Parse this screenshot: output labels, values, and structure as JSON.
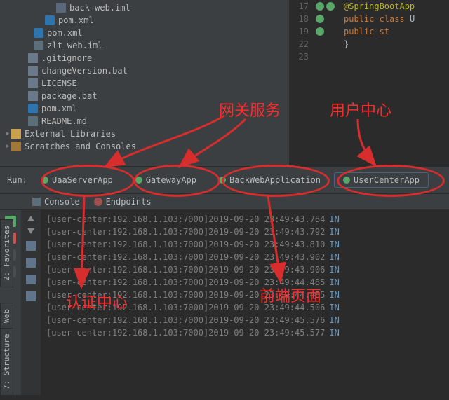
{
  "tree": {
    "items": [
      {
        "indent": 80,
        "icon": "i-folder",
        "label": "back-web.iml"
      },
      {
        "indent": 64,
        "icon": "i-m",
        "label": "pom.xml"
      },
      {
        "indent": 48,
        "icon": "i-m",
        "label": "pom.xml"
      },
      {
        "indent": 48,
        "icon": "i-x",
        "label": "zlt-web.iml"
      },
      {
        "indent": 40,
        "icon": "i-file",
        "label": ".gitignore"
      },
      {
        "indent": 40,
        "icon": "i-file",
        "label": "changeVersion.bat"
      },
      {
        "indent": 40,
        "icon": "i-file",
        "label": "LICENSE"
      },
      {
        "indent": 40,
        "icon": "i-file",
        "label": "package.bat"
      },
      {
        "indent": 40,
        "icon": "i-m",
        "label": "pom.xml"
      },
      {
        "indent": 40,
        "icon": "i-md",
        "label": "README.md"
      }
    ],
    "ext_libs": "External Libraries",
    "scratches": "Scratches and Consoles"
  },
  "editor": {
    "lines": [
      {
        "n": "17",
        "icons": [
          "#59a869",
          "#59a869"
        ],
        "segs": [
          {
            "t": "@SpringBootApp",
            "cls": "ann"
          }
        ]
      },
      {
        "n": "18",
        "icons": [
          "#59a869",
          ""
        ],
        "segs": [
          {
            "t": "public",
            "cls": "kw"
          },
          {
            "t": " class ",
            "cls": "kw"
          },
          {
            "t": "U",
            "cls": ""
          }
        ]
      },
      {
        "n": "19",
        "icons": [
          "#59a869",
          ""
        ],
        "segs": [
          {
            "t": "    public ",
            "cls": "kw"
          },
          {
            "t": "st",
            "cls": "kw"
          }
        ]
      },
      {
        "n": "22",
        "icons": [
          "",
          ""
        ],
        "segs": [
          {
            "t": "    }",
            "cls": ""
          }
        ]
      },
      {
        "n": "23",
        "icons": [
          "",
          ""
        ],
        "segs": []
      }
    ]
  },
  "run": {
    "label": "Run:",
    "tabs": [
      {
        "label": "UaaServerApp"
      },
      {
        "label": "GatewayApp"
      },
      {
        "label": "BackWebApplication"
      },
      {
        "label": "UserCenterApp"
      }
    ],
    "toolbar": {
      "console": "Console",
      "endpoints": "Endpoints"
    },
    "log_lines": [
      {
        "src": "[user-center:192.168.1.103:7000]",
        "ts": "2019-09-20 23:49:43.784"
      },
      {
        "src": "[user-center:192.168.1.103:7000]",
        "ts": "2019-09-20 23:49:43.792"
      },
      {
        "src": "[user-center:192.168.1.103:7000]",
        "ts": "2019-09-20 23:49:43.810"
      },
      {
        "src": "[user-center:192.168.1.103:7000]",
        "ts": "2019-09-20 23:49:43.902"
      },
      {
        "src": "[user-center:192.168.1.103:7000]",
        "ts": "2019-09-20 23:49:43.906"
      },
      {
        "src": "[user-center:192.168.1.103:7000]",
        "ts": "2019-09-20 23:49:44.485"
      },
      {
        "src": "[user-center:192.168.1.103:7000]",
        "ts": "2019-09-20 23:49:44.485"
      },
      {
        "src": "[user-center:192.168.1.103:7000]",
        "ts": "2019-09-20 23:49:44.506"
      },
      {
        "src": "[user-center:192.168.1.103:7000]",
        "ts": "2019-09-20 23:49:45.576"
      },
      {
        "src": "[user-center:192.168.1.103:7000]",
        "ts": "2019-09-20 23:49:45.577"
      }
    ],
    "log_suffix": "IN"
  },
  "vtabs": {
    "fav": "2: Favorites",
    "web": "Web",
    "struct": "7: Structure"
  },
  "annotations": {
    "gateway": "网关服务",
    "usercenter": "用户中心",
    "auth": "认证中心",
    "front": "前端页面"
  }
}
